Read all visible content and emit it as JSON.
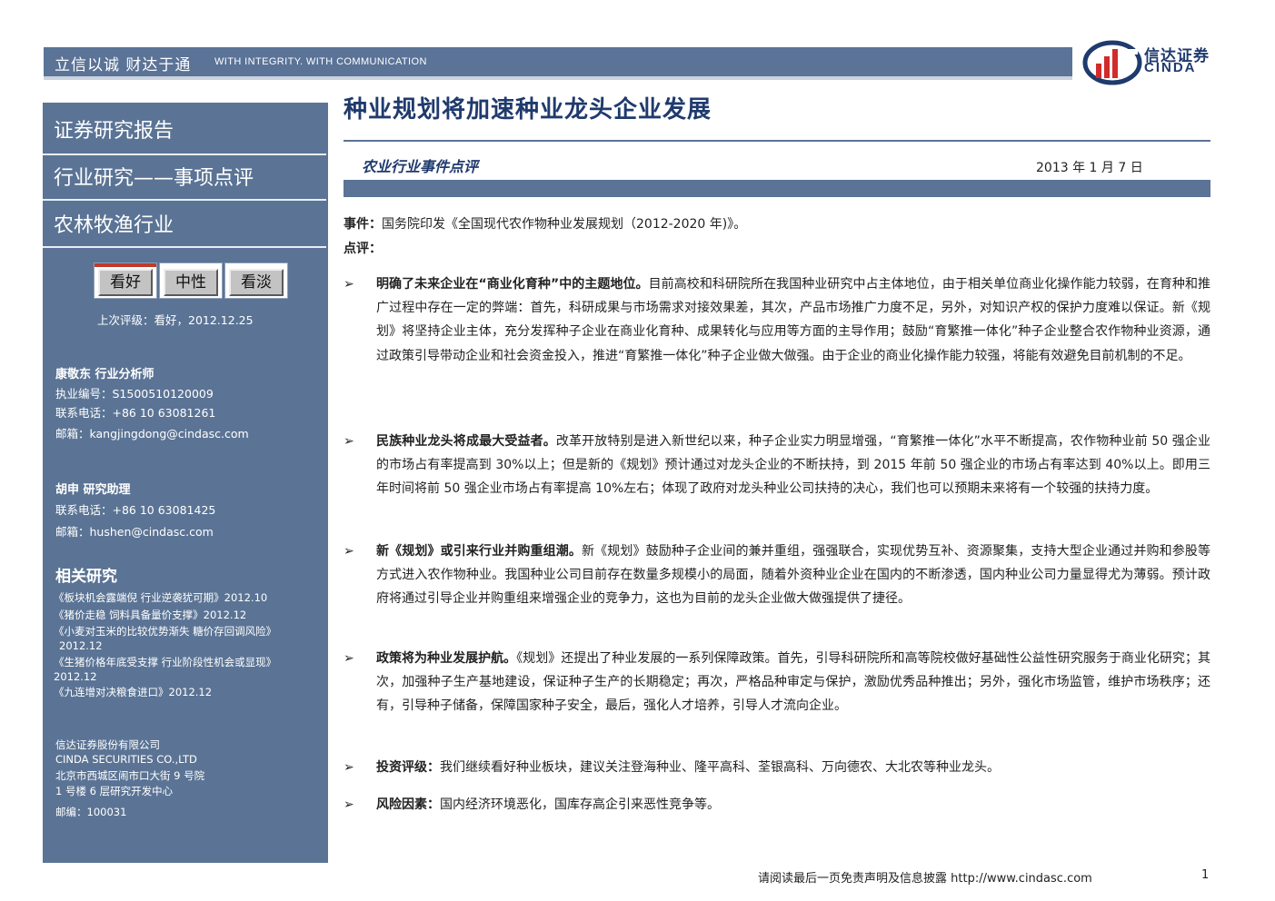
{
  "banner": {
    "slogan_cn": "立信以诚   财达于通",
    "slogan_en": "WITH INTEGRITY. WITH COMMUNICATION"
  },
  "logo": {
    "name_cn": "信达证券",
    "name_en": "CINDA"
  },
  "sidebar": {
    "headings": [
      "证券研究报告",
      "行业研究——事项点评",
      "农林牧渔行业"
    ],
    "ratings": [
      "看好",
      "中性",
      "看淡"
    ],
    "selected_rating": "看好",
    "last_rating": "上次评级：看好，2012.12.25",
    "analyst1": {
      "name": "康敬东  行业分析师",
      "license": "执业编号：S1500510120009",
      "phone": "联系电话：+86 10 63081261",
      "email": "邮箱：kangjingdong@cindasc.com"
    },
    "analyst2": {
      "name": "胡申  研究助理",
      "phone": "联系电话：+86 10 63081425",
      "email": "邮箱：hushen@cindasc.com"
    },
    "related_title": "相关研究",
    "related": [
      "《板块机会露端倪 行业逆袭犹可期》2012.10",
      "《猪价走稳 饲料具备量价支撑》2012.12",
      "《小麦对玉米的比较优势渐失 糖价存回调风险》",
      "2012.12",
      "《生猪价格年底受支撑 行业阶段性机会或显现》",
      "2012.12",
      "《九连增对决粮食进口》2012.12"
    ],
    "company": [
      "信达证券股份有限公司",
      "CINDA SECURITIES CO.,LTD",
      "北京市西城区闹市口大街 9 号院",
      "1 号楼 6 层研究开发中心",
      "邮编：100031"
    ]
  },
  "main": {
    "title": "种业规划将加速种业龙头企业发展",
    "subtitle": "农业行业事件点评",
    "date": "2013 年 1 月 7 日",
    "event_label": "事件：",
    "event_text": "国务院印发《全国现代农作物种业发展规划（2012-2020 年)》。",
    "review_label": "点评：",
    "items": [
      {
        "lead": "明确了未来企业在“商业化育种”中的主题地位。",
        "text": "目前高校和科研院所在我国种业研究中占主体地位，由于相关单位商业化操作能力较弱，在育种和推广过程中存在一定的弊端：首先，科研成果与市场需求对接效果差，其次，产品市场推广力度不足，另外，对知识产权的保护力度难以保证。新《规划》将坚持企业主体，充分发挥种子企业在商业化育种、成果转化与应用等方面的主导作用；鼓励“育繁推一体化”种子企业整合农作物种业资源，通过政策引导带动企业和社会资金投入，推进“育繁推一体化”种子企业做大做强。由于企业的商业化操作能力较强，将能有效避免目前机制的不足。"
      },
      {
        "lead": "民族种业龙头将成最大受益者。",
        "text": "改革开放特别是进入新世纪以来，种子企业实力明显增强，“育繁推一体化”水平不断提高，农作物种业前 50 强企业的市场占有率提高到 30%以上；但是新的《规划》预计通过对龙头企业的不断扶持，到 2015 年前 50 强企业的市场占有率达到 40%以上。即用三年时间将前 50 强企业市场占有率提高 10%左右；体现了政府对龙头种业公司扶持的决心，我们也可以预期未来将有一个较强的扶持力度。"
      },
      {
        "lead": "新《规划》或引来行业并购重组潮。",
        "text": "新《规划》鼓励种子企业间的兼并重组，强强联合，实现优势互补、资源聚集，支持大型企业通过并购和参股等方式进入农作物种业。我国种业公司目前存在数量多规模小的局面，随着外资种业企业在国内的不断渗透，国内种业公司力量显得尤为薄弱。预计政府将通过引导企业并购重组来增强企业的竞争力，这也为目前的龙头企业做大做强提供了捷径。"
      },
      {
        "lead": "政策将为种业发展护航。",
        "text": "《规划》还提出了种业发展的一系列保障政策。首先，引导科研院所和高等院校做好基础性公益性研究服务于商业化研究；其次，加强种子生产基地建设，保证种子生产的长期稳定；再次，严格品种审定与保护，激励优秀品种推出；另外，强化市场监管，维护市场秩序；还有，引导种子储备，保障国家种子安全，最后，强化人才培养，引导人才流向企业。"
      },
      {
        "lead": "投资评级：",
        "text": "我们继续看好种业板块，建议关注登海种业、隆平高科、荃银高科、万向德农、大北农等种业龙头。"
      },
      {
        "lead": "风险因素：",
        "text": "国内经济环境恶化，国库存高企引来恶性竞争等。"
      }
    ]
  },
  "footer": {
    "text": "请阅读最后一页免责声明及信息披露  http://www.cindasc.com",
    "page": "1"
  },
  "colors": {
    "brand_blue": "#5a7397",
    "title_navy": "#1f3a6d",
    "logo_red": "#d22b2b"
  }
}
